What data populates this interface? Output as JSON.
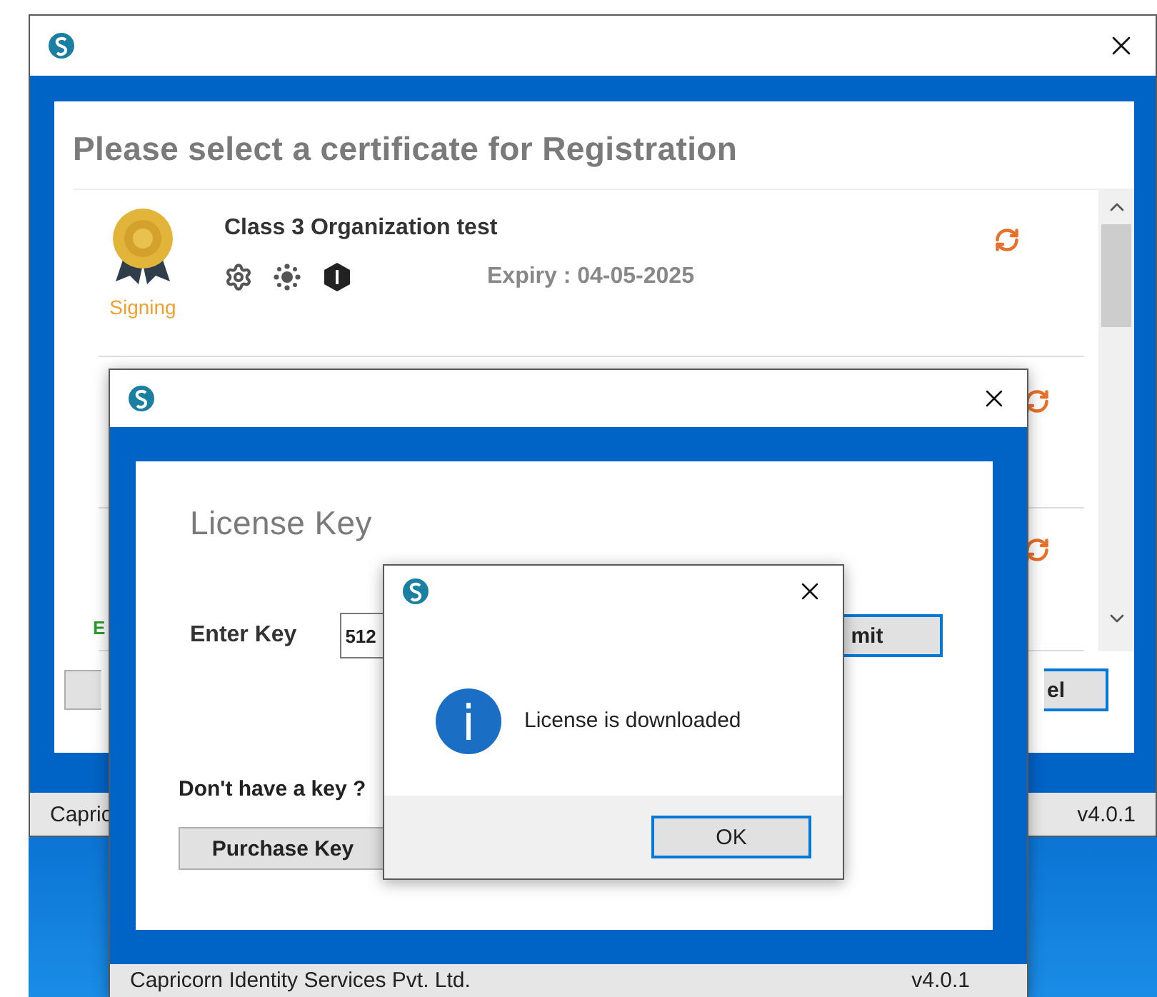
{
  "main_window": {
    "heading": "Please select a certificate for Registration",
    "certificates": [
      {
        "kind": "full",
        "name": "Class 3 Organization test",
        "usage": "Signing",
        "expiry": "Expiry : 04-05-2025"
      },
      {
        "kind": "covered"
      },
      {
        "kind": "covered"
      }
    ],
    "covered_note": "E",
    "cancel_label": "el",
    "status_bar": {
      "left": "Capric",
      "right": "v4.0.1"
    }
  },
  "license_window": {
    "heading": "License Key",
    "key_label": "Enter Key",
    "key_value": "512",
    "submit_label": "mit",
    "no_key_prompt": "Don't have a key ?",
    "purchase_label": "Purchase Key",
    "status_bar": {
      "left": "Capricorn Identity Services Pvt. Ltd.",
      "right": "v4.0.1"
    }
  },
  "message_dialog": {
    "message": "License is downloaded",
    "ok_label": "OK"
  }
}
